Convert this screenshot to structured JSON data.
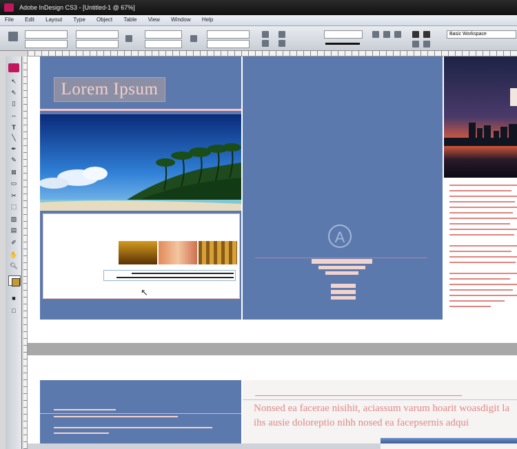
{
  "window": {
    "title": "Adobe InDesign CS3 - [Untitled-1 @ 67%]"
  },
  "menu": [
    "File",
    "Edit",
    "Layout",
    "Type",
    "Object",
    "Table",
    "View",
    "Window",
    "Help"
  ],
  "toolbar": {
    "workspace_label": "Basic Workspace",
    "zoom": "67%"
  },
  "document": {
    "heading": "Lorem Ipsum",
    "body_line_1": "Nonsed ea facerae nisihit, aciassum varum hoarit woasdigit la",
    "body_line_2": "ihs ausie doloreptio nihh nosed ea facepsernis adqui"
  },
  "colors": {
    "page_blue": "#5c79ad",
    "heading_text": "#f4cfc9",
    "body_text": "#e08a86",
    "guide_pink": "#f7c6c6"
  },
  "icons": [
    "select-tool-icon",
    "direct-select-icon",
    "type-tool-icon",
    "pen-tool-icon",
    "rectangle-frame-icon",
    "zoom-tool-icon",
    "hand-tool-icon",
    "text-cursor-icon"
  ]
}
